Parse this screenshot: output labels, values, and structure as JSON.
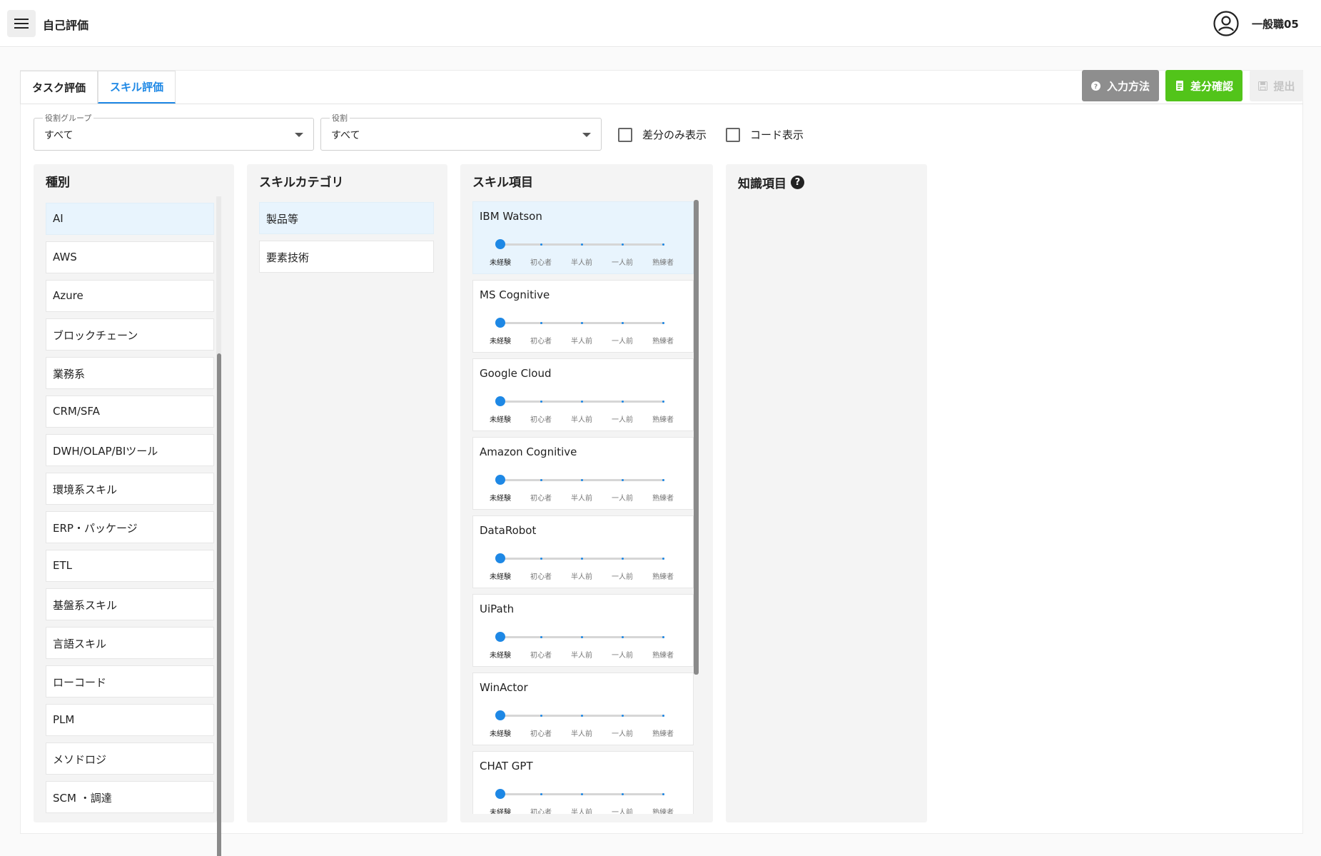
{
  "appbar": {
    "title": "自己評価",
    "user": "一般職05"
  },
  "tabs": [
    {
      "label": "タスク評価"
    },
    {
      "label": "スキル評価"
    }
  ],
  "actions": {
    "howto": "入力方法",
    "diff": "差分確認",
    "submit": "提出"
  },
  "filters": {
    "group": {
      "label": "役割グループ",
      "value": "すべて"
    },
    "role": {
      "label": "役割",
      "value": "すべて"
    },
    "diff_only": "差分のみ表示",
    "show_code": "コード表示"
  },
  "columns": {
    "type": {
      "title": "種別",
      "items": [
        "AI",
        "AWS",
        "Azure",
        "ブロックチェーン",
        "業務系",
        "CRM/SFA",
        "DWH/OLAP/BIツール",
        "環境系スキル",
        "ERP・パッケージ",
        "ETL",
        "基盤系スキル",
        "言語スキル",
        "ローコード",
        "PLM",
        "メソドロジ",
        "SCM ・調達"
      ]
    },
    "category": {
      "title": "スキルカテゴリ",
      "items": [
        "製品等",
        "要素技術"
      ]
    },
    "skill": {
      "title": "スキル項目",
      "levels": [
        "未経験",
        "初心者",
        "半人前",
        "一人前",
        "熟練者"
      ],
      "items": [
        {
          "name": "IBM Watson",
          "level": 0
        },
        {
          "name": "MS Cognitive",
          "level": 0
        },
        {
          "name": "Google Cloud",
          "level": 0
        },
        {
          "name": "Amazon Cognitive",
          "level": 0
        },
        {
          "name": "DataRobot",
          "level": 0
        },
        {
          "name": "UiPath",
          "level": 0
        },
        {
          "name": "WinActor",
          "level": 0
        },
        {
          "name": "CHAT GPT",
          "level": 0
        }
      ]
    },
    "knowledge": {
      "title": "知識項目"
    }
  }
}
